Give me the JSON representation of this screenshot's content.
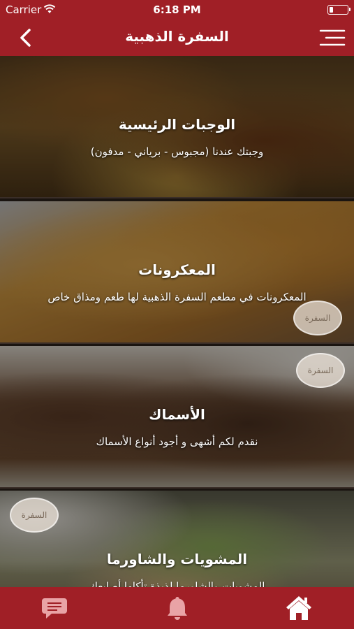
{
  "status_bar": {
    "carrier": "Carrier",
    "time": "6:18 PM",
    "icons": [
      "wifi-icon",
      "battery-icon"
    ]
  },
  "nav": {
    "title": "السفرة الذهبية",
    "back_icon": "chevron-left-icon",
    "menu_icon": "hamburger-menu-icon"
  },
  "categories": [
    {
      "title": "الوجبات الرئيسية",
      "description": "وجبتك عندنا (مجبوس - برياني - مدفون)"
    },
    {
      "title": "المعكرونات",
      "description": "المعكرونات في مطعم السفرة الذهبية لها طعم ومذاق خاص",
      "watermark": "السفرة"
    },
    {
      "title": "الأسماك",
      "description": "نقدم لكم أشهى و أجود أنواع الأسماك",
      "watermark": "السفرة"
    },
    {
      "title": "المشويات والشاورما",
      "description": "المشويات والشاورما لذيذة تأكلها أصابعك",
      "watermark": "السفرة"
    }
  ],
  "tab_bar": {
    "items": [
      "chat-icon",
      "bell-icon",
      "home-icon"
    ]
  },
  "colors": {
    "brand": "#a01f26",
    "text": "#ffffff"
  }
}
